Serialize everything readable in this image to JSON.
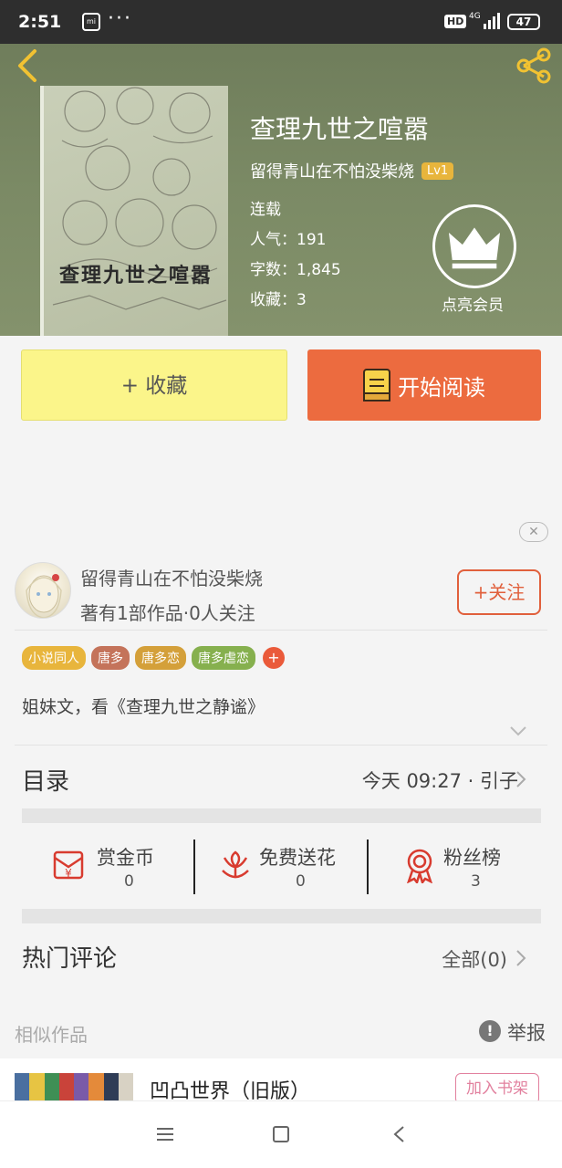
{
  "status_bar": {
    "time": "2:51",
    "dots": "···",
    "hd": "HD",
    "network": "4G",
    "battery": "47"
  },
  "book": {
    "title": "查理九世之喧嚣",
    "cover_title": "查理九世之喧嚣",
    "author": "留得青山在不怕没柴烧",
    "level": "Lv1",
    "status": "连载",
    "popularity": "人气：191",
    "word_count": "字数：1,845",
    "favorites": "收藏：3",
    "vip_label": "点亮会员"
  },
  "actions": {
    "collect_label": "+ 收藏",
    "read_label": "开始阅读"
  },
  "close_ad": "✕",
  "author_card": {
    "name": "留得青山在不怕没柴烧",
    "stats": "著有1部作品·0人关注",
    "follow_label": "+关注"
  },
  "tags": [
    {
      "label": "小说同人",
      "color": "#e8b53c"
    },
    {
      "label": "唐多",
      "color": "#c4735a"
    },
    {
      "label": "唐多恋",
      "color": "#d4a03a"
    },
    {
      "label": "唐多虐恋",
      "color": "#86b04e"
    }
  ],
  "tag_add": "+",
  "description": "姐妹文，看《查理九世之静谧》",
  "catalog": {
    "label": "目录",
    "latest": "今天 09:27 · 引子"
  },
  "stats": [
    {
      "name": "赏金币",
      "value": "0",
      "icon": "red-envelope-icon"
    },
    {
      "name": "免费送花",
      "value": "0",
      "icon": "flower-icon"
    },
    {
      "name": "粉丝榜",
      "value": "3",
      "icon": "medal-icon"
    }
  ],
  "comments": {
    "label": "热门评论",
    "all": "全部(0)"
  },
  "similar": {
    "label": "相似作品",
    "report_icon": "!",
    "report": "举报",
    "items": [
      {
        "title": "凹凸世界（旧版）",
        "add_label": "加入书架"
      }
    ]
  },
  "colors": {
    "accent_orange": "#ec6b3f",
    "collect_yellow": "#fbf58a",
    "header_green": "#7b8a65"
  }
}
